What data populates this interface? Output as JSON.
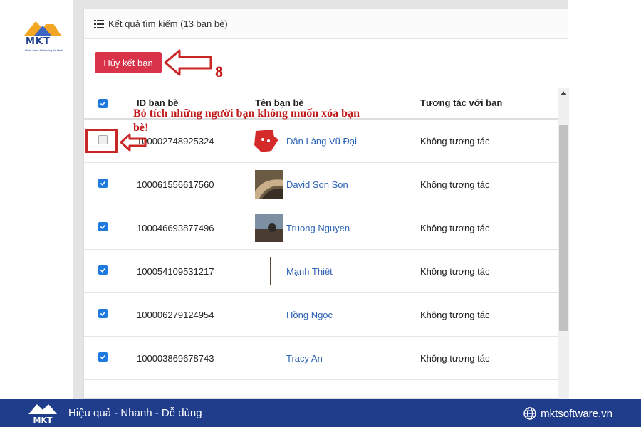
{
  "logo": {
    "brand": "MKT",
    "tagline": "Phần mềm Marketing đa kênh"
  },
  "card": {
    "header_title": "Kết quả tìm kiếm (13 bạn bè)",
    "unfriend_label": "Hủy kết bạn"
  },
  "table": {
    "headers": {
      "id": "ID bạn bè",
      "name": "Tên bạn bè",
      "interaction": "Tương tác với bạn"
    },
    "rows": [
      {
        "id": "100002748925324",
        "name": "Dân Làng Vũ Đại",
        "interaction": "Không tương tác",
        "checked": false
      },
      {
        "id": "100061556617560",
        "name": "David Son Son",
        "interaction": "Không tương tác",
        "checked": true
      },
      {
        "id": "100046693877496",
        "name": "Truong Nguyen",
        "interaction": "Không tương tác",
        "checked": true
      },
      {
        "id": "100054109531217",
        "name": "Mạnh Thiết",
        "interaction": "Không tương tác",
        "checked": true
      },
      {
        "id": "100006279124954",
        "name": "Hồng Ngọc",
        "interaction": "Không tương tác",
        "checked": true
      },
      {
        "id": "100003869678743",
        "name": "Tracy An",
        "interaction": "Không tương tác",
        "checked": true
      }
    ]
  },
  "annotations": {
    "step_number": "8",
    "instruction": "Bỏ tích những người bạn không muốn xóa bạn bè!",
    "color": "#c21a1a"
  },
  "footer": {
    "slogan": "Hiệu quả - Nhanh - Dễ dùng",
    "website": "mktsoftware.vn",
    "background": "#203d8c"
  },
  "colors": {
    "primary_button": "#d9334a",
    "checkbox": "#1f7ae0",
    "link": "#2d63b5"
  }
}
